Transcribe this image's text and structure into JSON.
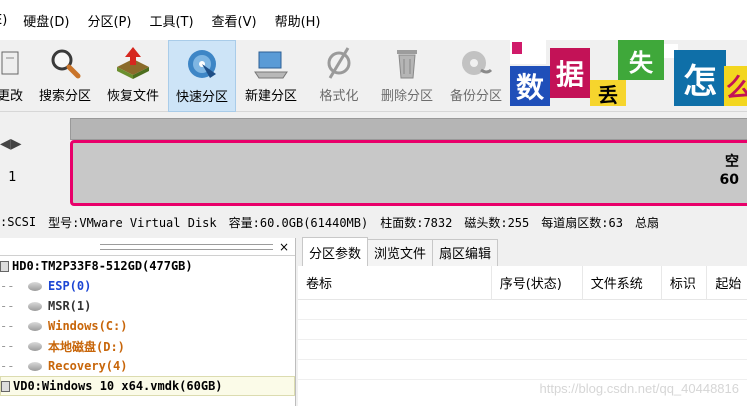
{
  "menu": [
    {
      "label": "E)"
    },
    {
      "label": "硬盘(D)"
    },
    {
      "label": "分区(P)"
    },
    {
      "label": "工具(T)"
    },
    {
      "label": "查看(V)"
    },
    {
      "label": "帮助(H)"
    }
  ],
  "toolbar": {
    "items": [
      {
        "label": "更改",
        "icon": "disk-change-icon"
      },
      {
        "label": "搜索分区",
        "icon": "magnifier-icon"
      },
      {
        "label": "恢复文件",
        "icon": "recover-file-icon"
      },
      {
        "label": "快速分区",
        "icon": "quick-partition-icon"
      },
      {
        "label": "新建分区",
        "icon": "new-partition-icon"
      },
      {
        "label": "格式化",
        "icon": "format-icon"
      },
      {
        "label": "删除分区",
        "icon": "trash-icon"
      },
      {
        "label": "备份分区",
        "icon": "backup-icon"
      }
    ]
  },
  "banner": {
    "chars": [
      "数",
      "据",
      "丢",
      "失",
      "怎",
      "么"
    ]
  },
  "diskmap": {
    "disk_label": "1",
    "free_label": "空",
    "free_size": "60"
  },
  "diskinfo": {
    "interface": ":SCSI",
    "model": "型号:VMware Virtual Disk",
    "capacity": "容量:60.0GB(61440MB)",
    "cylinders": "柱面数:7832",
    "heads": "磁头数:255",
    "sectors": "每道扇区数:63",
    "total": "总扇"
  },
  "tree": {
    "close_label": "×",
    "items": [
      {
        "label": "HD0:TM2P33F8-512GD(477GB)",
        "color": "#000000",
        "kind": "disk"
      },
      {
        "label": "ESP(0)",
        "color": "#1c46d4",
        "kind": "part"
      },
      {
        "label": "MSR(1)",
        "color": "#333333",
        "kind": "part"
      },
      {
        "label": "Windows(C:)",
        "color": "#c8660a",
        "kind": "part"
      },
      {
        "label": "本地磁盘(D:)",
        "color": "#c8660a",
        "kind": "part"
      },
      {
        "label": "Recovery(4)",
        "color": "#c8660a",
        "kind": "part"
      },
      {
        "label": "VD0:Windows 10 x64.vmdk(60GB)",
        "color": "#000000",
        "kind": "disk"
      }
    ]
  },
  "tabs": [
    {
      "label": "分区参数"
    },
    {
      "label": "浏览文件"
    },
    {
      "label": "扇区编辑"
    }
  ],
  "columns": [
    {
      "label": "卷标"
    },
    {
      "label": "序号(状态)"
    },
    {
      "label": "文件系统"
    },
    {
      "label": "标识"
    },
    {
      "label": "起始"
    }
  ],
  "watermark": "https://blog.csdn.net/qq_40448816"
}
